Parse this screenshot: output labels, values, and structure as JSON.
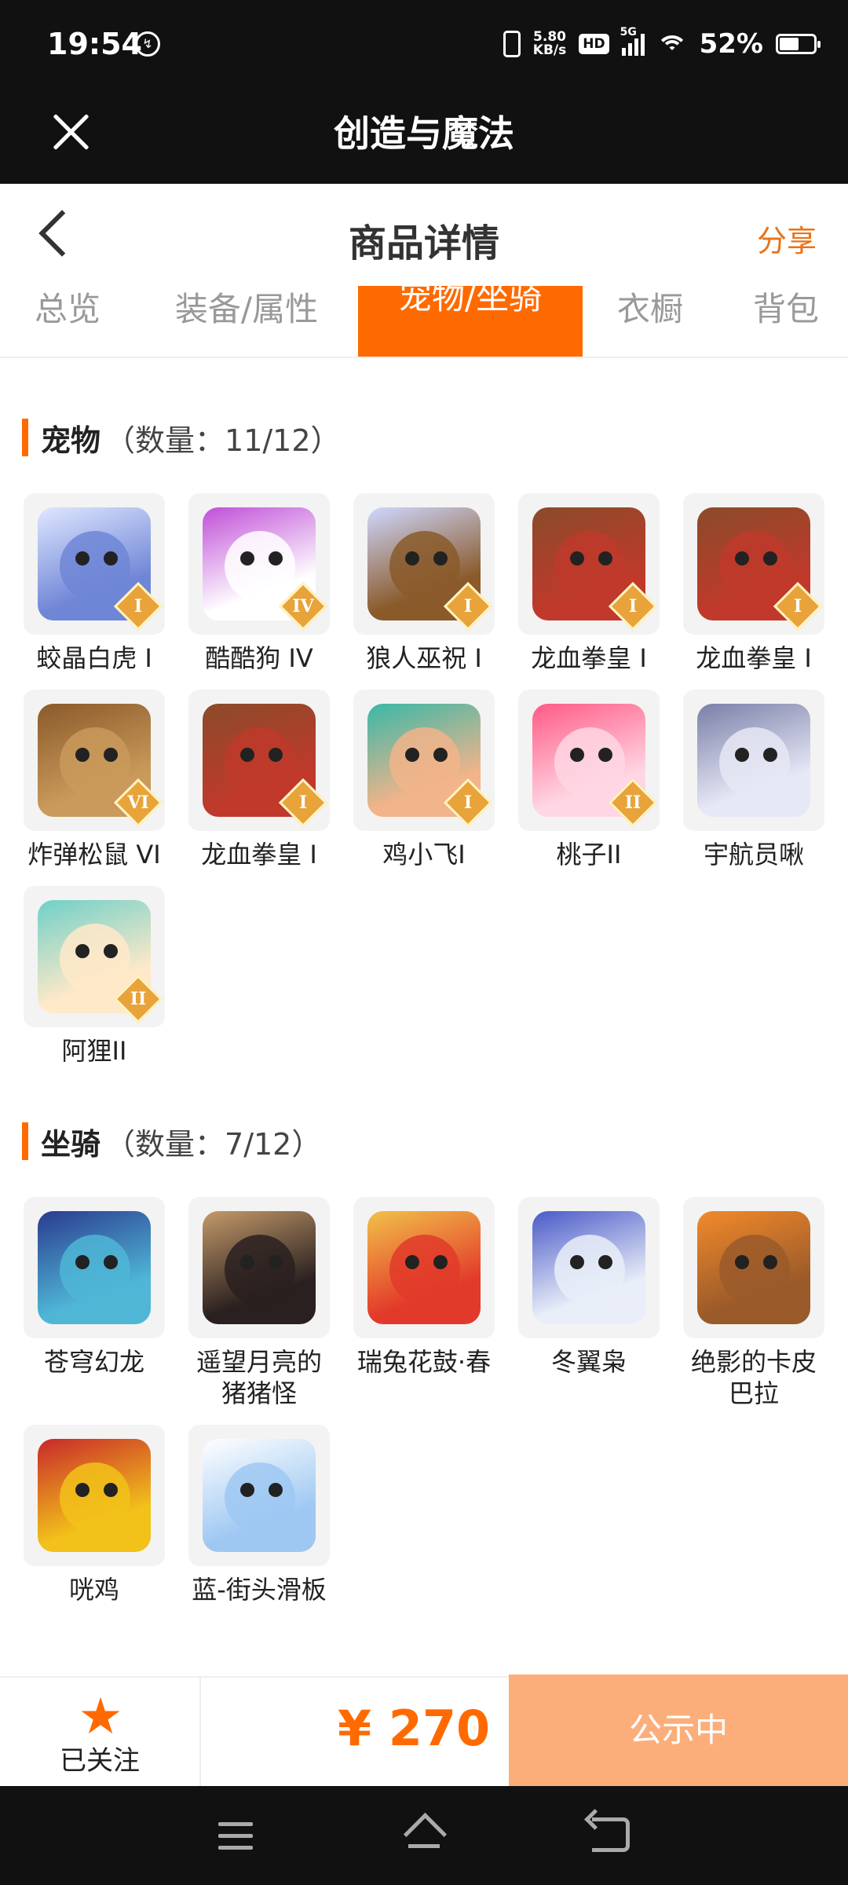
{
  "status_bar": {
    "time": "19:54",
    "net_speed_value": "5.80",
    "net_speed_unit": "KB/s",
    "hd": "HD",
    "network": "5G",
    "battery": "52%"
  },
  "app_bar": {
    "title": "创造与魔法"
  },
  "header": {
    "title": "商品详情",
    "share_label": "分享"
  },
  "tabs": [
    {
      "label": "总览",
      "active": false
    },
    {
      "label": "装备/属性",
      "active": false
    },
    {
      "label": "宠物/坐骑",
      "active": true
    },
    {
      "label": "衣橱",
      "active": false
    },
    {
      "label": "背包",
      "active": false
    }
  ],
  "pets": {
    "title": "宠物",
    "count": "（数量：11/12）",
    "items": [
      {
        "name": "蛟晶白虎 I",
        "badge": "I",
        "icon": "white-tiger-icon",
        "colors": [
          "#6f86d6",
          "#dfe7ff"
        ]
      },
      {
        "name": "酷酷狗 IV",
        "badge": "IV",
        "icon": "cool-dog-icon",
        "colors": [
          "#ffffff",
          "#c04fd8"
        ]
      },
      {
        "name": "狼人巫祝 I",
        "badge": "I",
        "icon": "werewolf-icon",
        "colors": [
          "#8a5a2a",
          "#cfd8ff"
        ]
      },
      {
        "name": "龙血拳皇 I",
        "badge": "I",
        "icon": "dragon-boxer-icon",
        "colors": [
          "#c0392b",
          "#8a4b2a"
        ]
      },
      {
        "name": "龙血拳皇 I",
        "badge": "I",
        "icon": "dragon-boxer-icon",
        "colors": [
          "#c0392b",
          "#8a4b2a"
        ]
      },
      {
        "name": "炸弹松鼠 VI",
        "badge": "VI",
        "icon": "bomb-squirrel-icon",
        "colors": [
          "#c99a5b",
          "#8a5a2a"
        ]
      },
      {
        "name": "龙血拳皇 I",
        "badge": "I",
        "icon": "dragon-boxer-icon",
        "colors": [
          "#c0392b",
          "#8a4b2a"
        ]
      },
      {
        "name": "鸡小飞I",
        "badge": "I",
        "icon": "chicken-fly-icon",
        "colors": [
          "#f2b48a",
          "#38b8a8"
        ]
      },
      {
        "name": "桃子II",
        "badge": "II",
        "icon": "peach-fox-icon",
        "colors": [
          "#ffd6e3",
          "#ff5a86"
        ]
      },
      {
        "name": "宇航员啾",
        "badge": "",
        "icon": "astronaut-icon",
        "colors": [
          "#e6e8f5",
          "#7a7fa8"
        ]
      },
      {
        "name": "阿狸II",
        "badge": "II",
        "icon": "ali-fox-icon",
        "colors": [
          "#ffe9c9",
          "#6fd0c8"
        ]
      }
    ]
  },
  "mounts": {
    "title": "坐骑",
    "count": "（数量：7/12）",
    "items": [
      {
        "name": "苍穹幻龙",
        "icon": "sky-dragon-icon",
        "colors": [
          "#4fb6d6",
          "#2a3b8f"
        ]
      },
      {
        "name": "遥望月亮的猪猪怪",
        "icon": "moon-pig-icon",
        "colors": [
          "#2a2020",
          "#c49a6a"
        ]
      },
      {
        "name": "瑞兔花鼓·春",
        "icon": "rabbit-drum-icon",
        "colors": [
          "#e23a2a",
          "#f2c14a"
        ]
      },
      {
        "name": "冬翼枭",
        "icon": "winter-owl-icon",
        "colors": [
          "#e9eef8",
          "#4a5ac8"
        ]
      },
      {
        "name": "绝影的卡皮巴拉",
        "icon": "capybara-icon",
        "colors": [
          "#9a5a2a",
          "#f28a2a"
        ]
      },
      {
        "name": "咣鸡",
        "icon": "rooster-icon",
        "colors": [
          "#f2c21a",
          "#c8282a"
        ]
      },
      {
        "name": "蓝-街头滑板",
        "icon": "skateboard-icon",
        "colors": [
          "#9ec8f2",
          "#ffffff"
        ]
      }
    ]
  },
  "bottom": {
    "follow_label": "已关注",
    "price": "¥ 270",
    "status_label": "公示中"
  },
  "colors": {
    "accent": "#ff6a00",
    "status_button": "#fcae7a",
    "dark_bar": "#111111"
  }
}
